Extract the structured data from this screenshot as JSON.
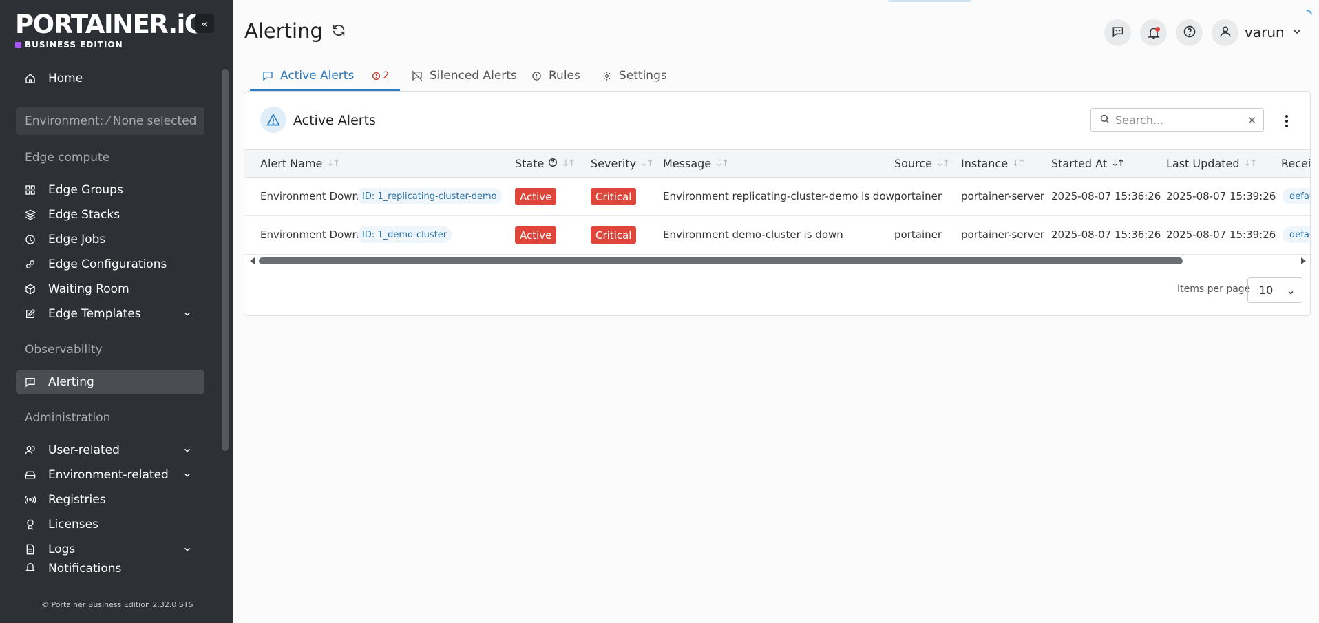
{
  "app": {
    "logo": "PORTAINER.iO",
    "edition_label": "BUSINESS EDITION",
    "footer": "© Portainer Business Edition  2.32.0 STS"
  },
  "sidebar": {
    "home": "Home",
    "environment": "Environment: ⁄ None selected",
    "sections": {
      "edge": "Edge compute",
      "observability": "Observability",
      "administration": "Administration"
    },
    "items": [
      {
        "label": "Edge Groups",
        "icon": "grid-icon"
      },
      {
        "label": "Edge Stacks",
        "icon": "layers-icon"
      },
      {
        "label": "Edge Jobs",
        "icon": "clock-icon"
      },
      {
        "label": "Edge Configurations",
        "icon": "settings-gears-icon"
      },
      {
        "label": "Waiting Room",
        "icon": "box-icon"
      },
      {
        "label": "Edge Templates",
        "icon": "edit-icon"
      },
      {
        "label": "Alerting",
        "icon": "message-alert-icon"
      },
      {
        "label": "User-related",
        "icon": "users-icon"
      },
      {
        "label": "Environment-related",
        "icon": "hard-drive-icon"
      },
      {
        "label": "Registries",
        "icon": "radio-icon"
      },
      {
        "label": "Licenses",
        "icon": "award-icon"
      },
      {
        "label": "Logs",
        "icon": "file-text-icon"
      },
      {
        "label": "Notifications",
        "icon": "bell-icon"
      }
    ]
  },
  "header": {
    "title": "Alerting",
    "user": "varun"
  },
  "tabs": {
    "active_alerts": "Active Alerts",
    "active_count": "2",
    "silenced": "Silenced Alerts",
    "rules": "Rules",
    "settings": "Settings"
  },
  "card": {
    "title": "Active Alerts",
    "search_placeholder": "Search...",
    "columns": [
      "Alert Name",
      "State",
      "Severity",
      "Message",
      "Source",
      "Instance",
      "Started At",
      "Last Updated",
      "Recei"
    ],
    "rows": [
      {
        "name": "Environment Down",
        "id": "ID: 1_replicating-cluster-demo",
        "state": "Active",
        "severity": "Critical",
        "message": "Environment replicating-cluster-demo is down",
        "source": "portainer",
        "instance": "portainer-server",
        "started": "2025-08-07 15:36:26",
        "updated": "2025-08-07 15:39:26",
        "receiver": "defau"
      },
      {
        "name": "Environment Down",
        "id": "ID: 1_demo-cluster",
        "state": "Active",
        "severity": "Critical",
        "message": "Environment demo-cluster is down",
        "source": "portainer",
        "instance": "portainer-server",
        "started": "2025-08-07 15:36:26",
        "updated": "2025-08-07 15:39:26",
        "receiver": "defau"
      }
    ],
    "items_per_page_label": "Items per page",
    "items_per_page_value": "10"
  }
}
